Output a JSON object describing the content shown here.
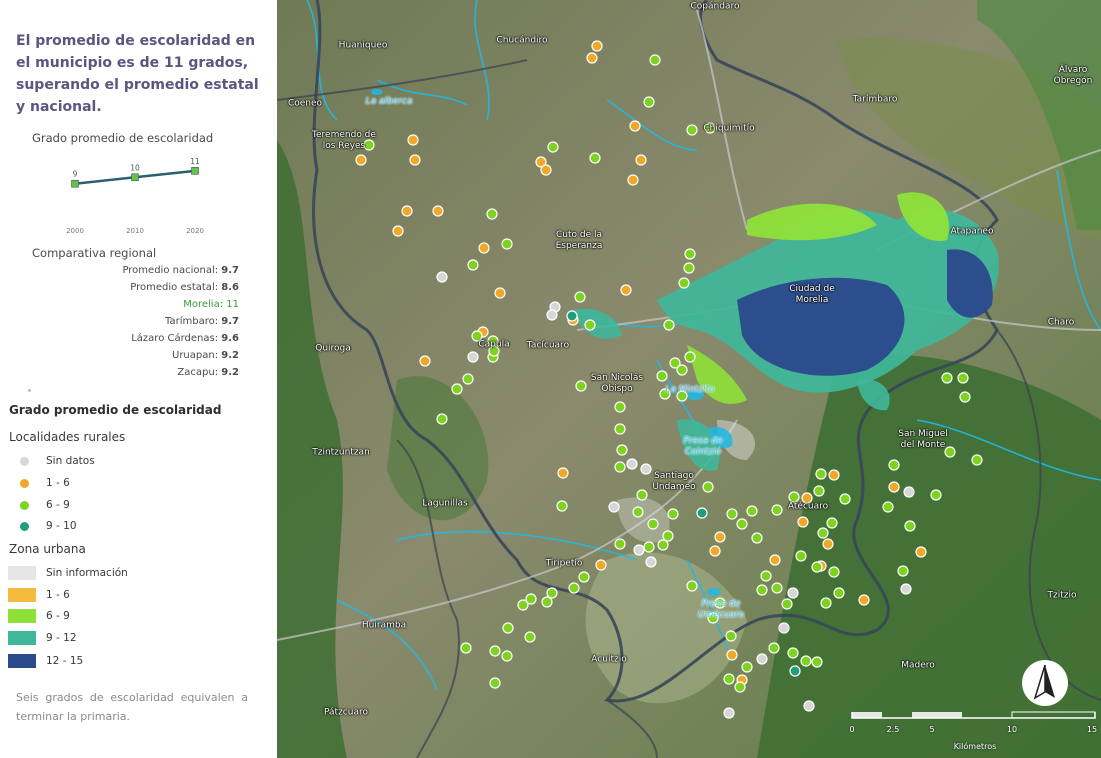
{
  "headline": "El promedio de escolaridad en el municipio es de 11 grados, superando el promedio estatal y nacional.",
  "trend_chart": {
    "title": "Grado promedio de escolaridad",
    "years": [
      "2000",
      "2010",
      "2020"
    ],
    "values": [
      "9",
      "10",
      "11"
    ],
    "line_color": "#2e5f6e",
    "marker_color": "#6abf45"
  },
  "chart_data": {
    "type": "line",
    "title": "Grado promedio de escolaridad",
    "categories": [
      "2000",
      "2010",
      "2020"
    ],
    "values": [
      9,
      10,
      11
    ],
    "ylim": [
      6,
      13
    ]
  },
  "regional": {
    "title": "Comparativa regional",
    "rows": [
      {
        "label": "Promedio nacional:",
        "value": "9.7"
      },
      {
        "label": "Promedio estatal:",
        "value": "8.6"
      },
      {
        "label": "Morelia:",
        "value": "11"
      },
      {
        "label": "Tarímbaro:",
        "value": "9.7"
      },
      {
        "label": "Lázaro Cárdenas:",
        "value": "9.6"
      },
      {
        "label": "Uruapan:",
        "value": "9.2"
      },
      {
        "label": "Zacapu:",
        "value": "9.2"
      }
    ],
    "highlight_color": "#3a9a3a"
  },
  "legend": {
    "title": "Grado promedio de escolaridad",
    "rural_title": "Localidades rurales",
    "rural_items": [
      {
        "label": "Sin datos",
        "color": "#d7d7d7"
      },
      {
        "label": "1 - 6",
        "color": "#f0a829"
      },
      {
        "label": "6 - 9",
        "color": "#7ed321"
      },
      {
        "label": "9 - 10",
        "color": "#1e9e7a"
      }
    ],
    "urban_title": "Zona urbana",
    "urban_items": [
      {
        "label": "Sin información",
        "color": "#e6e6e6"
      },
      {
        "label": "1 - 6",
        "color": "#f4bc3f"
      },
      {
        "label": "6 - 9",
        "color": "#8fe13a"
      },
      {
        "label": "9 - 12",
        "color": "#3fb79a"
      },
      {
        "label": "12 - 15",
        "color": "#2b4a8c"
      }
    ]
  },
  "footnote": "Seis grados de escolaridad equivalen a terminar la primaria.",
  "map": {
    "places": [
      "Copándaro",
      "Chucándiro",
      "Huaniqueo",
      "Álvaro Obregón",
      "Coeneo",
      "Tarímbaro",
      "Teremendo de los Reyes",
      "Chiquimitío",
      "Cuto de la Esperanza",
      "Atapaneo",
      "Ciudad de Morelia",
      "Charo",
      "Quiroga",
      "Capula",
      "Tacícuaro",
      "San Nicolás Obispo",
      "Tzintzuntzan",
      "San Miguel del Monte",
      "Santiago Undameo",
      "Atécuaro",
      "Lagunillas",
      "Tiripetío",
      "Huiramba",
      "Acuitzio",
      "Tzitzio",
      "Madero",
      "Pátzcuaro"
    ],
    "water": [
      "La alberca",
      "La Mintzita",
      "Presa de Cointzio",
      "Presa de Umécuaro"
    ],
    "scale": {
      "ticks": [
        "0",
        "2.5",
        "5",
        "10",
        "15"
      ],
      "unit": "Kilómetros"
    }
  }
}
